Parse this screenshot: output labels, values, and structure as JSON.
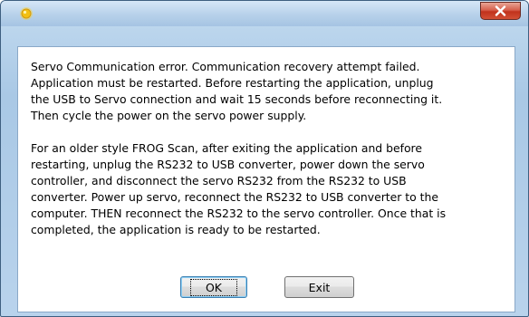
{
  "window": {
    "title": ""
  },
  "dialog": {
    "paragraphs": [
      "Servo Communication error.  Communication recovery attempt failed.\nApplication must be restarted.  Before restarting the application, unplug\nthe USB to Servo connection and wait 15 seconds before reconnecting it.\nThen cycle the power on the servo power supply.",
      "For an older style FROG Scan, after exiting the application and  before\nrestarting, unplug the RS232 to USB converter,  power down the servo\ncontroller, and disconnect  the servo RS232 from the RS232 to USB\nconverter.  Power up servo, reconnect the RS232 to USB converter to the\ncomputer.  THEN reconnect the RS232 to the servo controller.   Once that is\ncompleted, the application is ready to be restarted."
    ]
  },
  "buttons": {
    "ok_label": "OK",
    "exit_label": "Exit",
    "close_icon": "close-icon"
  },
  "icons": {
    "app_icon": "sun-icon"
  },
  "colors": {
    "close_button": "#c1321c",
    "app_icon": "#f2c014",
    "frame": "#a9c8e5"
  }
}
